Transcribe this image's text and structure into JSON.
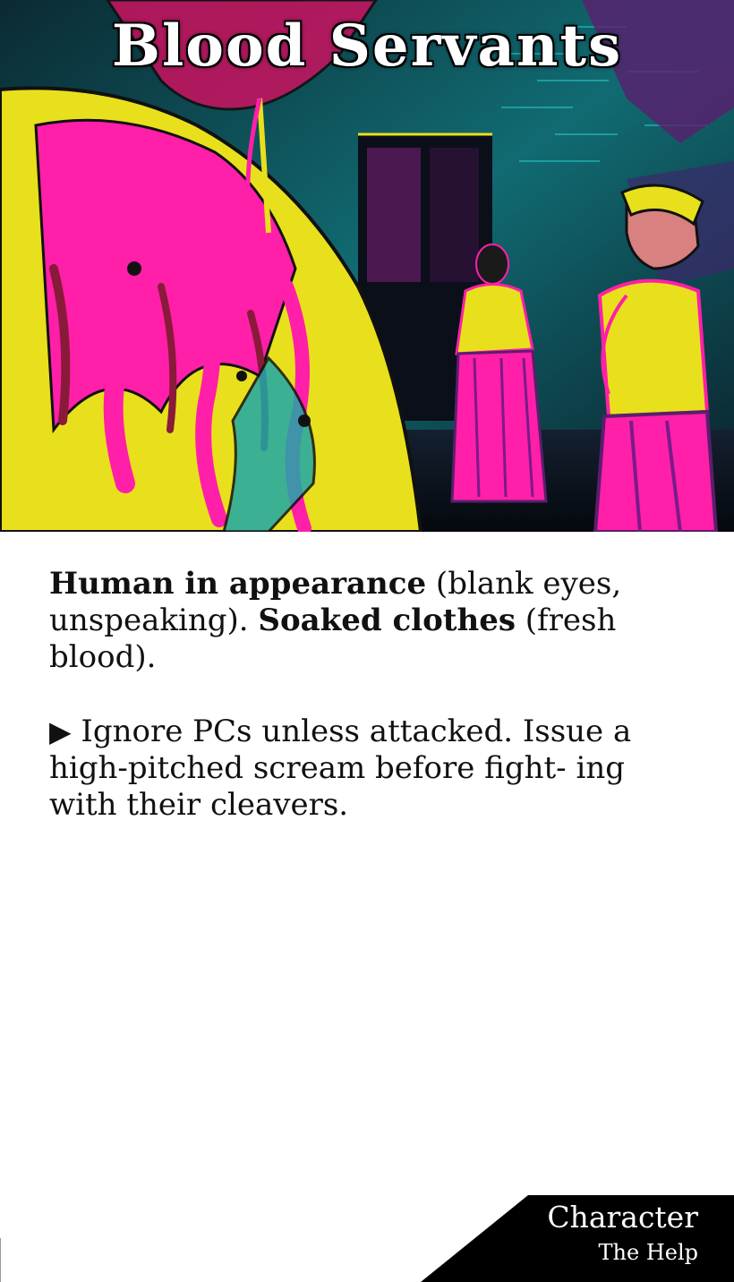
{
  "card": {
    "title": "Blood Servants",
    "art_alt": "Blood-splattered servants in yellow and pink dresses in a dark teal-lit corridor",
    "desc": {
      "bold1": "Human in appearance",
      "text1": " (blank eyes, unspeaking). ",
      "bold2": "Soaked clothes",
      "text2": " (fresh blood)."
    },
    "behavior": {
      "icon": "play-triangle-icon",
      "text": "Ignore PCs unless attacked. Issue a high-pitched scream before fight- ing with their cleavers."
    },
    "corner": {
      "type": "Character",
      "subtitle": "The Help"
    }
  },
  "colors": {
    "magenta": "#ff1fa8",
    "yellow": "#e8e01c",
    "teal": "#1fc7c7",
    "dark": "#07121a"
  }
}
